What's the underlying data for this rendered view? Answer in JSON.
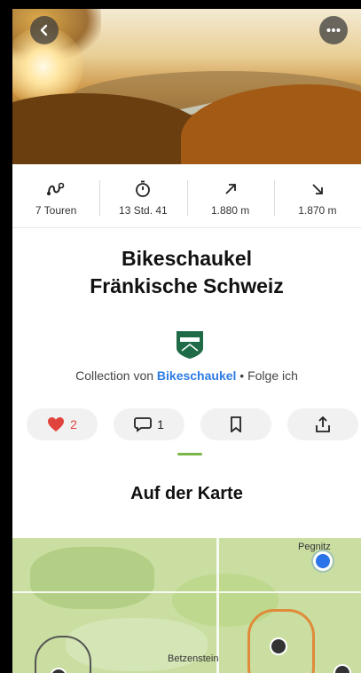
{
  "hero": {
    "image_alt": "autumn valley with sunset"
  },
  "stats": [
    {
      "icon": "tour-route-icon",
      "value": "7 Touren"
    },
    {
      "icon": "stopwatch-icon",
      "value": "13 Std. 41"
    },
    {
      "icon": "ascent-arrow-icon",
      "value": "1.880 m"
    },
    {
      "icon": "descent-arrow-icon",
      "value": "1.870 m"
    }
  ],
  "title": {
    "line1": "Bikeschaukel",
    "line2": "Fränkische Schweiz"
  },
  "byline": {
    "prefix": "Collection von ",
    "author": "Bikeschaukel",
    "suffix": " • Folge ich"
  },
  "actions": {
    "likes": "2",
    "comments": "1"
  },
  "section": {
    "map_title": "Auf der Karte"
  },
  "map": {
    "town1": "Pegnitz",
    "town2": "Betzenstein"
  },
  "colors": {
    "accent_green": "#7ab648",
    "link_blue": "#2d7be5",
    "heart_red": "#e0433b"
  }
}
